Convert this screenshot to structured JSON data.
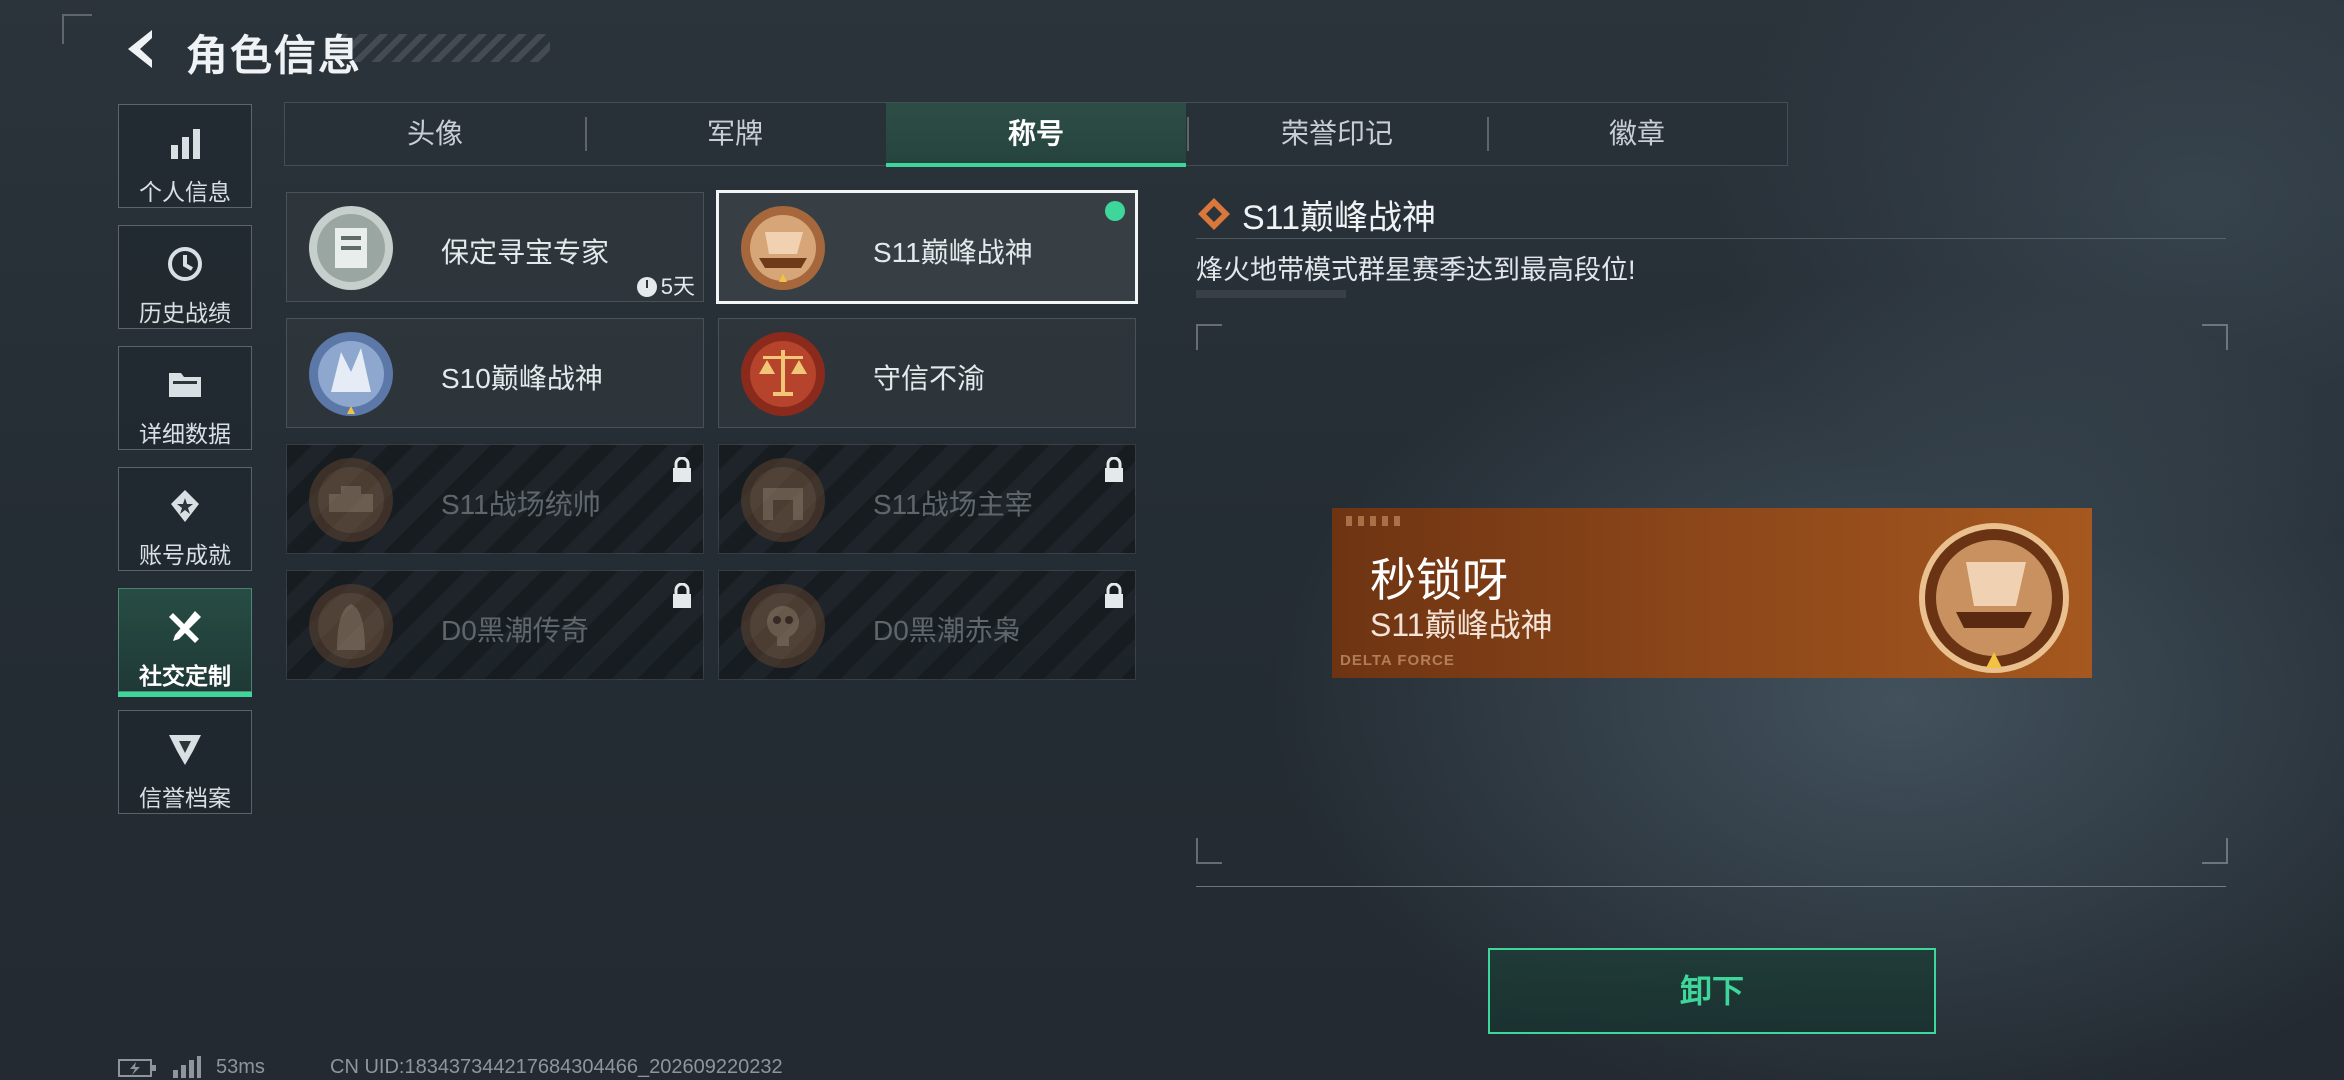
{
  "header": {
    "title": "角色信息"
  },
  "sidebar": {
    "items": [
      {
        "label": "个人信息",
        "icon": "bar-chart-icon"
      },
      {
        "label": "历史战绩",
        "icon": "history-clock-icon"
      },
      {
        "label": "详细数据",
        "icon": "folder-icon"
      },
      {
        "label": "账号成就",
        "icon": "achievement-icon"
      },
      {
        "label": "社交定制",
        "icon": "wrench-tools-icon",
        "active": true
      },
      {
        "label": "信誉档案",
        "icon": "credit-shield-icon"
      }
    ]
  },
  "tabs": [
    {
      "label": "头像"
    },
    {
      "label": "军牌"
    },
    {
      "label": "称号",
      "active": true
    },
    {
      "label": "荣誉印记"
    },
    {
      "label": "徽章"
    }
  ],
  "titles": [
    {
      "name": "保定寻宝专家",
      "timer": "5天",
      "locked": false
    },
    {
      "name": "S11巅峰战神",
      "selected": true,
      "equipped": true
    },
    {
      "name": "S10巅峰战神",
      "locked": false
    },
    {
      "name": "守信不渝",
      "locked": false
    },
    {
      "name": "S11战场统帅",
      "locked": true
    },
    {
      "name": "S11战场主宰",
      "locked": true
    },
    {
      "name": "D0黑潮传奇",
      "locked": true
    },
    {
      "name": "D0黑潮赤枭",
      "locked": true
    }
  ],
  "detail": {
    "title": "S11巅峰战神",
    "description": "烽火地带模式群星赛季达到最高段位!"
  },
  "preview": {
    "player_name": "秒锁呀",
    "title": "S11巅峰战神",
    "brand": "DELTA FORCE"
  },
  "actions": {
    "unequip_label": "卸下"
  },
  "status_bar": {
    "ping": "53ms",
    "uid": "CN UID:183437344217684304466_202609220232"
  },
  "colors": {
    "accent": "#3fd69b",
    "banner": "#8a4519"
  }
}
